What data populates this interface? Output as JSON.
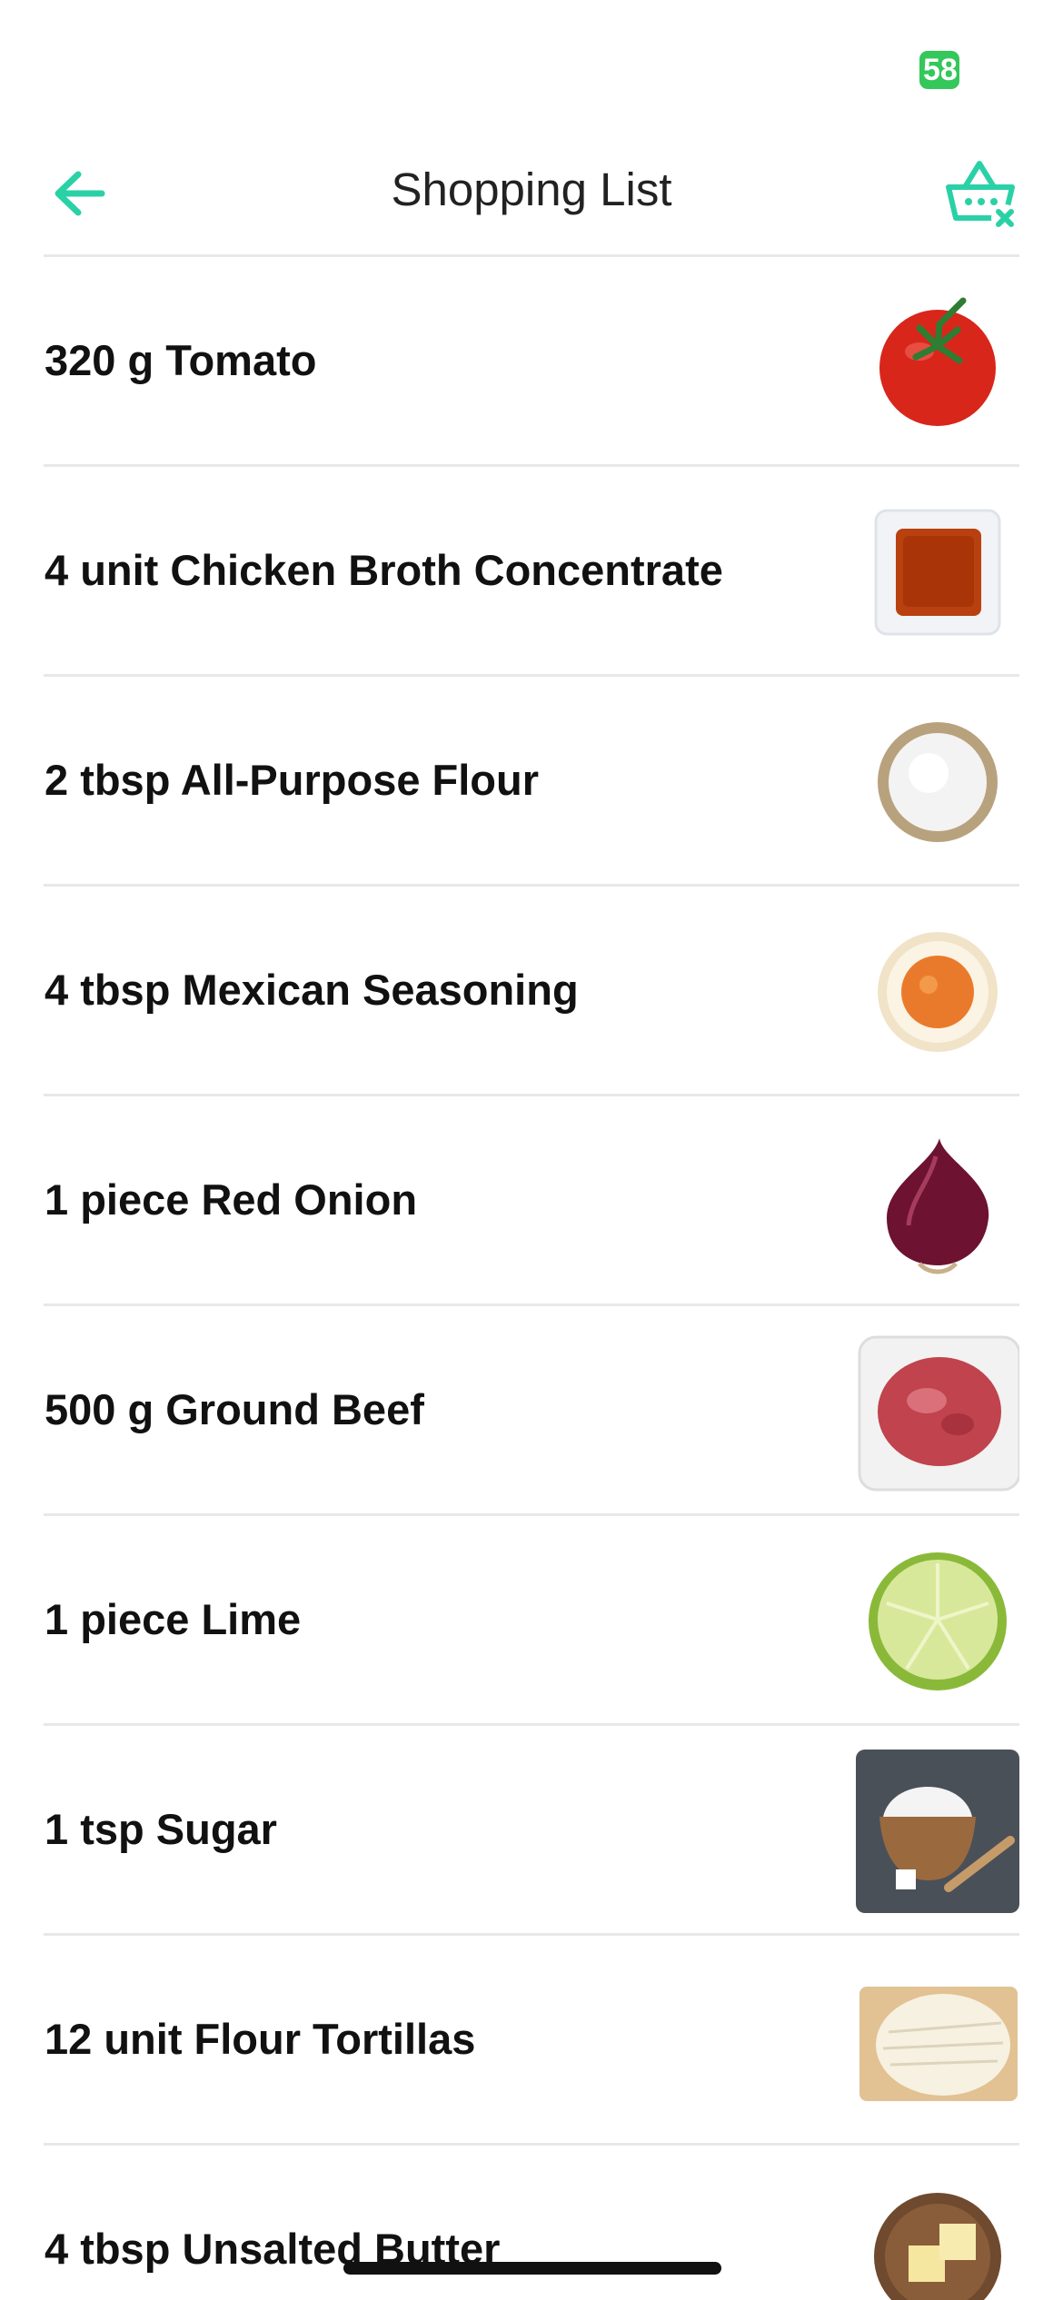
{
  "status_bar": {
    "battery_level": "58",
    "battery_color": "#34c759"
  },
  "header": {
    "title": "Shopping List",
    "back_icon": "arrow-left-icon",
    "clear_icon": "basket-clear-icon",
    "accent_color": "#2bd1a6"
  },
  "items": [
    {
      "label": "320 g Tomato",
      "image": "tomato-image"
    },
    {
      "label": "4 unit Chicken Broth Concentrate",
      "image": "chicken-broth-image"
    },
    {
      "label": "2 tbsp All-Purpose Flour",
      "image": "flour-image"
    },
    {
      "label": "4 tbsp Mexican Seasoning",
      "image": "mexican-seasoning-image"
    },
    {
      "label": "1 piece Red Onion",
      "image": "red-onion-image"
    },
    {
      "label": "500 g Ground Beef",
      "image": "ground-beef-image"
    },
    {
      "label": "1 piece Lime",
      "image": "lime-image"
    },
    {
      "label": "1 tsp Sugar",
      "image": "sugar-image"
    },
    {
      "label": "12 unit Flour Tortillas",
      "image": "tortillas-image"
    },
    {
      "label": "4 tbsp Unsalted Butter",
      "image": "butter-image"
    }
  ]
}
